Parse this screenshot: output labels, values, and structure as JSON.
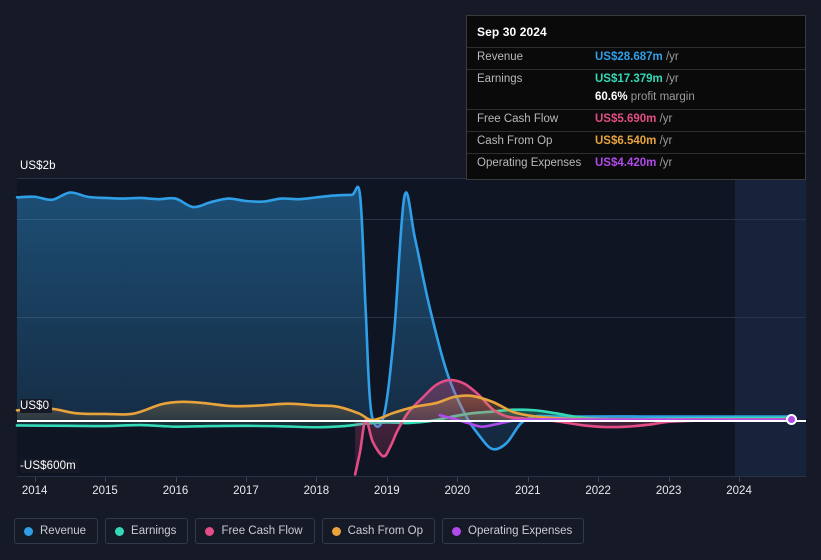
{
  "tooltip": {
    "date": "Sep 30 2024",
    "rows": [
      {
        "label": "Revenue",
        "value": "US$28.687m",
        "suffix": " /yr",
        "color": "#2f9fe8"
      },
      {
        "label": "Earnings",
        "value": "US$17.379m",
        "suffix": " /yr",
        "color": "#34d9b5"
      },
      {
        "label": "",
        "value": "60.6%",
        "suffix": " profit margin",
        "color": "#ffffff"
      },
      {
        "label": "Free Cash Flow",
        "value": "US$5.690m",
        "suffix": " /yr",
        "color": "#e34d86"
      },
      {
        "label": "Cash From Op",
        "value": "US$6.540m",
        "suffix": " /yr",
        "color": "#e8a33d"
      },
      {
        "label": "Operating Expenses",
        "value": "US$4.420m",
        "suffix": " /yr",
        "color": "#b14aea"
      }
    ]
  },
  "legend": {
    "items": [
      {
        "label": "Revenue",
        "color": "#2f9fe8"
      },
      {
        "label": "Earnings",
        "color": "#34d9b5"
      },
      {
        "label": "Free Cash Flow",
        "color": "#e34d86"
      },
      {
        "label": "Cash From Op",
        "color": "#e8a33d"
      },
      {
        "label": "Operating Expenses",
        "color": "#b14aea"
      }
    ]
  },
  "chart_data": {
    "type": "area",
    "title": "",
    "xlabel": "",
    "ylabel": "",
    "currency": "USD",
    "grid": true,
    "legend_position": "bottom",
    "y_axis": {
      "labels": [
        "US$2b",
        "US$0",
        "-US$600m"
      ],
      "values": [
        2000,
        0,
        -600
      ],
      "unit": "millions",
      "ylim": [
        -600,
        2400
      ],
      "gridlines": [
        2000,
        1660,
        850,
        0
      ]
    },
    "x_axis": {
      "tick_labels": [
        "2014",
        "2015",
        "2016",
        "2017",
        "2018",
        "2019",
        "2020",
        "2021",
        "2022",
        "2023",
        "2024"
      ],
      "range": [
        "2013-09-30",
        "2024-12-31"
      ],
      "forecast_start": "2024-05"
    },
    "series": [
      {
        "name": "Revenue",
        "color": "#2f9fe8",
        "filled": true,
        "x": [
          2013.75,
          2014.0,
          2014.25,
          2014.5,
          2014.75,
          2015.0,
          2015.25,
          2015.5,
          2015.75,
          2016.0,
          2016.25,
          2016.5,
          2016.75,
          2017.0,
          2017.25,
          2017.5,
          2017.75,
          2018.0,
          2018.25,
          2018.5,
          2018.62,
          2018.7,
          2018.78,
          2018.95,
          2019.1,
          2019.25,
          2019.4,
          2019.6,
          2019.85,
          2020.1,
          2020.3,
          2020.5,
          2020.7,
          2020.9,
          2021.1,
          2021.4,
          2021.8,
          2022.2,
          2022.6,
          2023.0,
          2023.5,
          2024.0,
          2024.5,
          2024.75
        ],
        "values": [
          1840,
          1845,
          1820,
          1880,
          1845,
          1835,
          1830,
          1835,
          1825,
          1830,
          1760,
          1800,
          1830,
          1810,
          1805,
          1830,
          1825,
          1840,
          1855,
          1860,
          1855,
          900,
          60,
          20,
          700,
          1850,
          1500,
          950,
          400,
          60,
          -120,
          -240,
          -190,
          -30,
          30,
          28,
          29,
          30,
          29,
          29,
          29,
          29,
          28.7,
          28.687
        ]
      },
      {
        "name": "Earnings",
        "color": "#34d9b5",
        "filled": true,
        "x": [
          2013.75,
          2014.5,
          2015.0,
          2015.5,
          2016.0,
          2016.5,
          2017.0,
          2017.5,
          2018.0,
          2018.4,
          2018.7,
          2019.0,
          2019.3,
          2019.6,
          2019.9,
          2020.2,
          2020.5,
          2020.8,
          2021.1,
          2021.4,
          2021.7,
          2022.0,
          2022.4,
          2022.8,
          2023.2,
          2023.7,
          2024.2,
          2024.75
        ],
        "values": [
          -45,
          -48,
          -50,
          -42,
          -55,
          -50,
          -48,
          -52,
          -60,
          -50,
          -30,
          -20,
          -25,
          -10,
          25,
          55,
          70,
          85,
          80,
          55,
          25,
          10,
          8,
          10,
          13,
          15,
          17,
          17.379
        ]
      },
      {
        "name": "Free Cash Flow",
        "color": "#e34d86",
        "filled": true,
        "x": [
          2018.55,
          2018.62,
          2018.7,
          2018.8,
          2018.95,
          2019.05,
          2019.15,
          2019.3,
          2019.5,
          2019.7,
          2019.9,
          2020.1,
          2020.3,
          2020.5,
          2020.7,
          2020.9,
          2021.1,
          2021.4,
          2021.8,
          2022.1,
          2022.4,
          2022.7,
          2023.0,
          2023.4,
          2023.9,
          2024.3,
          2024.75
        ],
        "values": [
          -450,
          -260,
          0,
          -180,
          -300,
          -220,
          -90,
          60,
          180,
          290,
          330,
          300,
          210,
          90,
          30,
          15,
          5,
          -10,
          -45,
          -58,
          -55,
          -40,
          -15,
          -5,
          2,
          5,
          5.69
        ]
      },
      {
        "name": "Cash From Op",
        "color": "#e8a33d",
        "filled": true,
        "x": [
          2013.75,
          2014.2,
          2014.6,
          2015.0,
          2015.4,
          2015.8,
          2016.1,
          2016.4,
          2016.8,
          2017.2,
          2017.6,
          2018.0,
          2018.3,
          2018.6,
          2018.8,
          2019.1,
          2019.4,
          2019.7,
          2019.95,
          2020.2,
          2020.5,
          2020.8,
          2021.1,
          2021.5,
          2022.0,
          2022.5,
          2023.0,
          2023.5,
          2024.0,
          2024.75
        ],
        "values": [
          80,
          95,
          55,
          50,
          52,
          130,
          150,
          140,
          115,
          120,
          135,
          120,
          110,
          55,
          0,
          60,
          110,
          140,
          190,
          200,
          150,
          65,
          30,
          12,
          8,
          5,
          5,
          6,
          6,
          6.54
        ]
      },
      {
        "name": "Operating Expenses",
        "color": "#b14aea",
        "filled": false,
        "x": [
          2019.75,
          2019.95,
          2020.15,
          2020.35,
          2020.55,
          2020.8,
          2021.1,
          2021.5,
          2022.0,
          2022.6,
          2023.2,
          2023.8,
          2024.3,
          2024.75
        ],
        "values": [
          40,
          10,
          -25,
          -55,
          -35,
          -5,
          4,
          4,
          4,
          4,
          4,
          4,
          4,
          4.42
        ]
      }
    ],
    "endpoint_marker": {
      "series": "Operating Expenses",
      "color": "#b14aea"
    }
  }
}
